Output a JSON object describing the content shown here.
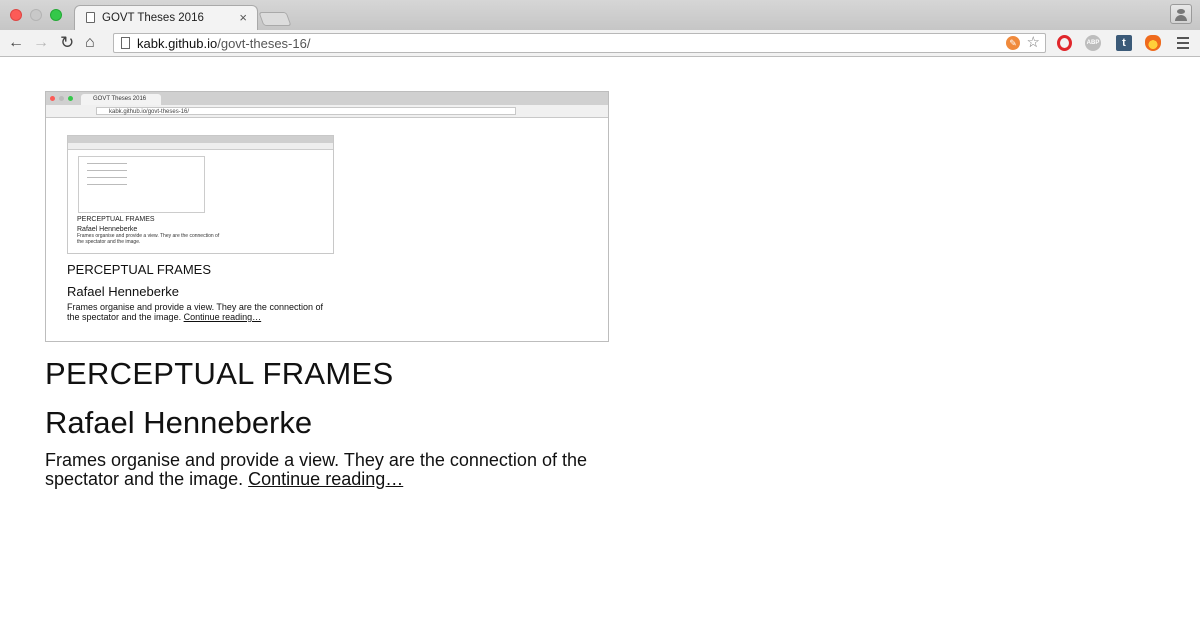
{
  "browser": {
    "tab_title": "GOVT Theses 2016",
    "tab_close": "×",
    "url_host": "kabk.github.io",
    "url_path": "/govt-theses-16/",
    "nav": {
      "back": "←",
      "forward": "→",
      "reload": "↻",
      "home": "⌂"
    },
    "star": "☆",
    "extensions": {
      "abp": "ABP",
      "tumblr": "t",
      "pen": "✎"
    }
  },
  "article": {
    "title": "PERCEPTUAL FRAMES",
    "author": "Rafael Henneberke",
    "description": "Frames organise and provide a view. They are the connection of the spectator and the image.",
    "link_label": "Continue reading…"
  },
  "preview": {
    "tab_title": "GOVT Theses 2016",
    "url": "kabk.github.io/govt-theses-16/",
    "title": "PERCEPTUAL FRAMES",
    "author": "Rafael Henneberke",
    "description": "Frames organise and provide a view. They are the connection of the spectator and the image.",
    "link_label": "Continue reading…"
  }
}
